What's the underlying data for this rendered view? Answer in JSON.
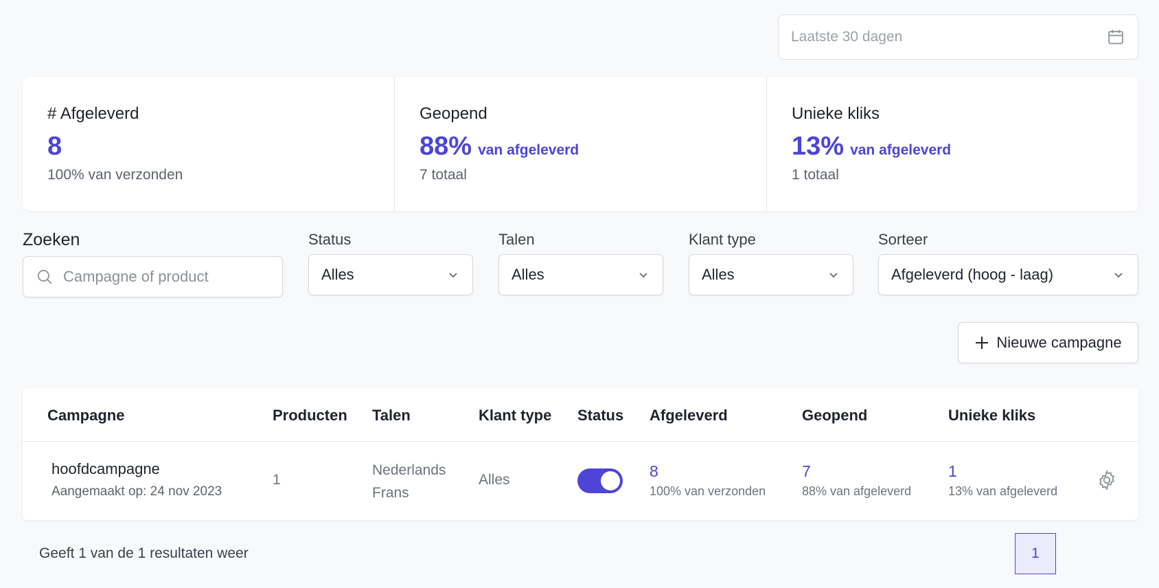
{
  "date_filter": {
    "placeholder": "Laatste 30 dagen",
    "icon": "calendar-icon"
  },
  "stats": [
    {
      "label": "# Afgeleverd",
      "value": "8",
      "suffix": "",
      "sub": "100% van verzonden"
    },
    {
      "label": "Geopend",
      "value": "88%",
      "suffix": "van afgeleverd",
      "sub": "7 totaal"
    },
    {
      "label": "Unieke kliks",
      "value": "13%",
      "suffix": "van afgeleverd",
      "sub": "1 totaal"
    }
  ],
  "filters": {
    "search_label": "Zoeken",
    "search_placeholder": "Campagne of product",
    "status": {
      "label": "Status",
      "value": "Alles"
    },
    "talen": {
      "label": "Talen",
      "value": "Alles"
    },
    "klant_type": {
      "label": "Klant type",
      "value": "Alles"
    },
    "sorteer": {
      "label": "Sorteer",
      "value": "Afgeleverd (hoog - laag)"
    }
  },
  "new_campaign_label": "Nieuwe campagne",
  "table": {
    "headers": {
      "campagne": "Campagne",
      "producten": "Producten",
      "talen": "Talen",
      "klant_type": "Klant type",
      "status": "Status",
      "afgeleverd": "Afgeleverd",
      "geopend": "Geopend",
      "unieke_kliks": "Unieke kliks"
    },
    "rows": [
      {
        "name": "hoofdcampagne",
        "created": "Aangemaakt op: 24 nov 2023",
        "producten": "1",
        "talen": [
          "Nederlands",
          "Frans"
        ],
        "klant_type": "Alles",
        "status_active": true,
        "afgeleverd": {
          "value": "8",
          "sub": "100% van verzonden"
        },
        "geopend": {
          "value": "7",
          "sub": "88% van afgeleverd"
        },
        "unieke_kliks": {
          "value": "1",
          "sub": "13% van afgeleverd"
        }
      }
    ]
  },
  "footer": {
    "results_text": "Geeft 1 van de 1 resultaten weer",
    "current_page": "1"
  },
  "colors": {
    "accent": "#4c45d8",
    "background": "#f8f9fb"
  }
}
